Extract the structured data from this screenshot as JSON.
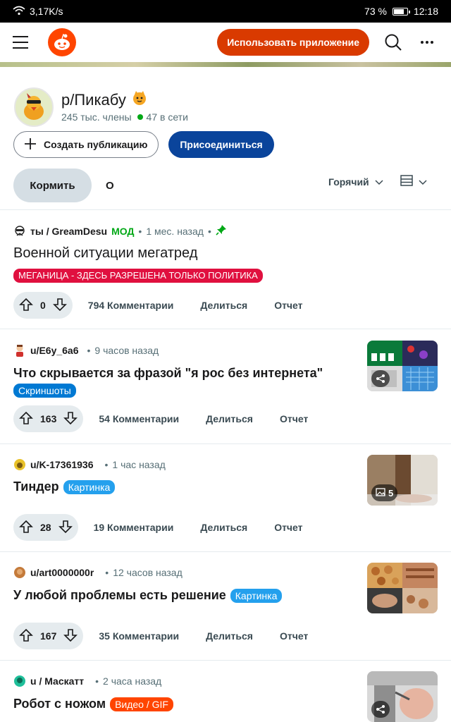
{
  "status": {
    "speed": "3,17K/s",
    "battery": "73 %",
    "time": "12:18"
  },
  "topbar": {
    "use_app": "Использовать приложение"
  },
  "community": {
    "name": "р/Пикабу",
    "members": "245 тыс. члены",
    "online": "47 в сети"
  },
  "buttons": {
    "create": "Создать публикацию",
    "join": "Присоединиться"
  },
  "tabs": {
    "feed": "Кормить",
    "about": "О"
  },
  "sort": {
    "label": "Горячий"
  },
  "posts": [
    {
      "user": "ты / GreamDesu",
      "mod": "МОД",
      "time": "1 мес. назад",
      "title": "Военной ситуации мегатред",
      "flair": "МЕГАНИЦА - ЗДЕСЬ РАЗРЕШЕНА ТОЛЬКО ПОЛИТИКА",
      "flair_color": "#e0103f",
      "score": "0",
      "comments": "794 Комментарии",
      "share": "Делиться",
      "report": "Отчет"
    },
    {
      "user": "u/Е6у_6а6",
      "time": "9 часов назад",
      "title": "Что скрывается за фразой \"я рос без интернета\"",
      "flair": "Скриншоты",
      "flair_color": "#0079d3",
      "score": "163",
      "comments": "54 Комментарии",
      "share": "Делиться",
      "report": "Отчет"
    },
    {
      "user": "u/K-17361936",
      "time": "1 час назад",
      "title": "Тиндер",
      "flair": "Картинка",
      "flair_color": "#24a0ed",
      "score": "28",
      "comments": "19 Комментарии",
      "share": "Делиться",
      "report": "Отчет",
      "gallery_count": "5"
    },
    {
      "user": "u/art0000000r",
      "time": "12 часов назад",
      "title": "У любой проблемы есть решение",
      "flair": "Картинка",
      "flair_color": "#24a0ed",
      "score": "167",
      "comments": "35 Комментарии",
      "share": "Делиться",
      "report": "Отчет"
    },
    {
      "user": "u / Маскатт",
      "time": "2 часа назад",
      "title": "Робот с ножом",
      "flair": "Видео / GIF",
      "flair_color": "#ff4500"
    }
  ]
}
